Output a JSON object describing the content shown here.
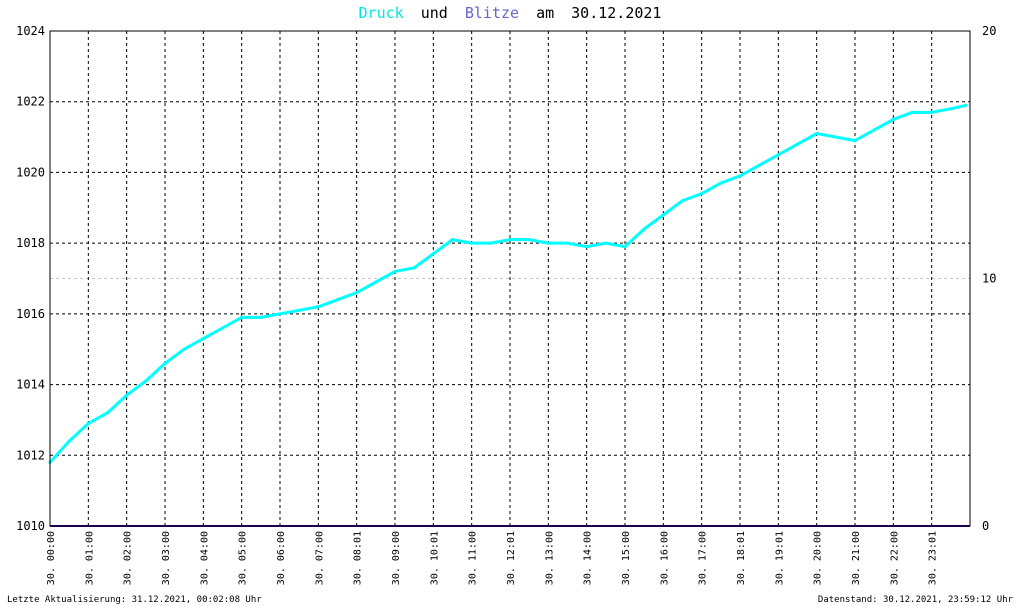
{
  "chart_data": {
    "type": "line",
    "title_parts": {
      "series1": "Druck",
      "conj": "und",
      "series2": "Blitze",
      "prefix_date": "am",
      "date": "30.12.2021"
    },
    "colors": {
      "druck": "#00ffff",
      "blitze": "#330099",
      "grid": "#000000",
      "grid_minor": "#c8c8c8"
    },
    "y_left": {
      "min": 1010,
      "max": 1024,
      "ticks": [
        "1010",
        "1012",
        "1014",
        "1016",
        "1018",
        "1020",
        "1022",
        "1024"
      ]
    },
    "y_right": {
      "min": 0,
      "max": 20,
      "ticks": [
        "0",
        "10",
        "20"
      ]
    },
    "x_range_hours": [
      0,
      24
    ],
    "x_ticks": [
      {
        "h": 0,
        "label": "30. 00:00"
      },
      {
        "h": 1,
        "label": "30. 01:00"
      },
      {
        "h": 2,
        "label": "30. 02:00"
      },
      {
        "h": 3,
        "label": "30. 03:00"
      },
      {
        "h": 4,
        "label": "30. 04:00"
      },
      {
        "h": 5,
        "label": "30. 05:00"
      },
      {
        "h": 6,
        "label": "30. 06:00"
      },
      {
        "h": 7,
        "label": "30. 07:00"
      },
      {
        "h": 8,
        "label": "30. 08:01"
      },
      {
        "h": 9,
        "label": "30. 09:00"
      },
      {
        "h": 10,
        "label": "30. 10:01"
      },
      {
        "h": 11,
        "label": "30. 11:00"
      },
      {
        "h": 12,
        "label": "30. 12:01"
      },
      {
        "h": 13,
        "label": "30. 13:00"
      },
      {
        "h": 14,
        "label": "30. 14:00"
      },
      {
        "h": 15,
        "label": "30. 15:00"
      },
      {
        "h": 16,
        "label": "30. 16:00"
      },
      {
        "h": 17,
        "label": "30. 17:00"
      },
      {
        "h": 18,
        "label": "30. 18:01"
      },
      {
        "h": 19,
        "label": "30. 19:01"
      },
      {
        "h": 20,
        "label": "30. 20:00"
      },
      {
        "h": 21,
        "label": "30. 21:00"
      },
      {
        "h": 22,
        "label": "30. 22:00"
      },
      {
        "h": 23,
        "label": "30. 23:01"
      }
    ],
    "series": [
      {
        "name": "Druck",
        "x": [
          0,
          0.5,
          1,
          1.5,
          2,
          2.5,
          3,
          3.5,
          4,
          4.5,
          5,
          5.5,
          6,
          6.5,
          7,
          7.5,
          8,
          8.5,
          9,
          9.5,
          10,
          10.5,
          11,
          11.5,
          12,
          12.5,
          13,
          13.5,
          14,
          14.5,
          15,
          15.5,
          16,
          16.5,
          17,
          17.5,
          18,
          18.5,
          19,
          19.5,
          20,
          20.5,
          21,
          21.5,
          22,
          22.5,
          23,
          23.5,
          23.9
        ],
        "values": [
          1011.8,
          1012.4,
          1012.9,
          1013.2,
          1013.7,
          1014.1,
          1014.6,
          1015.0,
          1015.3,
          1015.6,
          1015.9,
          1015.9,
          1016.0,
          1016.1,
          1016.2,
          1016.4,
          1016.6,
          1016.9,
          1017.2,
          1017.3,
          1017.7,
          1018.1,
          1018.0,
          1018.0,
          1018.1,
          1018.1,
          1018.0,
          1018.0,
          1017.9,
          1018.0,
          1017.9,
          1018.4,
          1018.8,
          1019.2,
          1019.4,
          1019.7,
          1019.9,
          1020.2,
          1020.5,
          1020.8,
          1021.1,
          1021.0,
          1020.9,
          1021.2,
          1021.5,
          1021.7,
          1021.7,
          1021.8,
          1021.9
        ]
      },
      {
        "name": "Blitze",
        "axis": "right",
        "x": [
          0,
          24
        ],
        "values": [
          0,
          0
        ]
      }
    ]
  },
  "footer": {
    "left": "Letzte Aktualisierung: 31.12.2021, 00:02:08 Uhr",
    "right": "Datenstand: 30.12.2021, 23:59:12 Uhr"
  }
}
